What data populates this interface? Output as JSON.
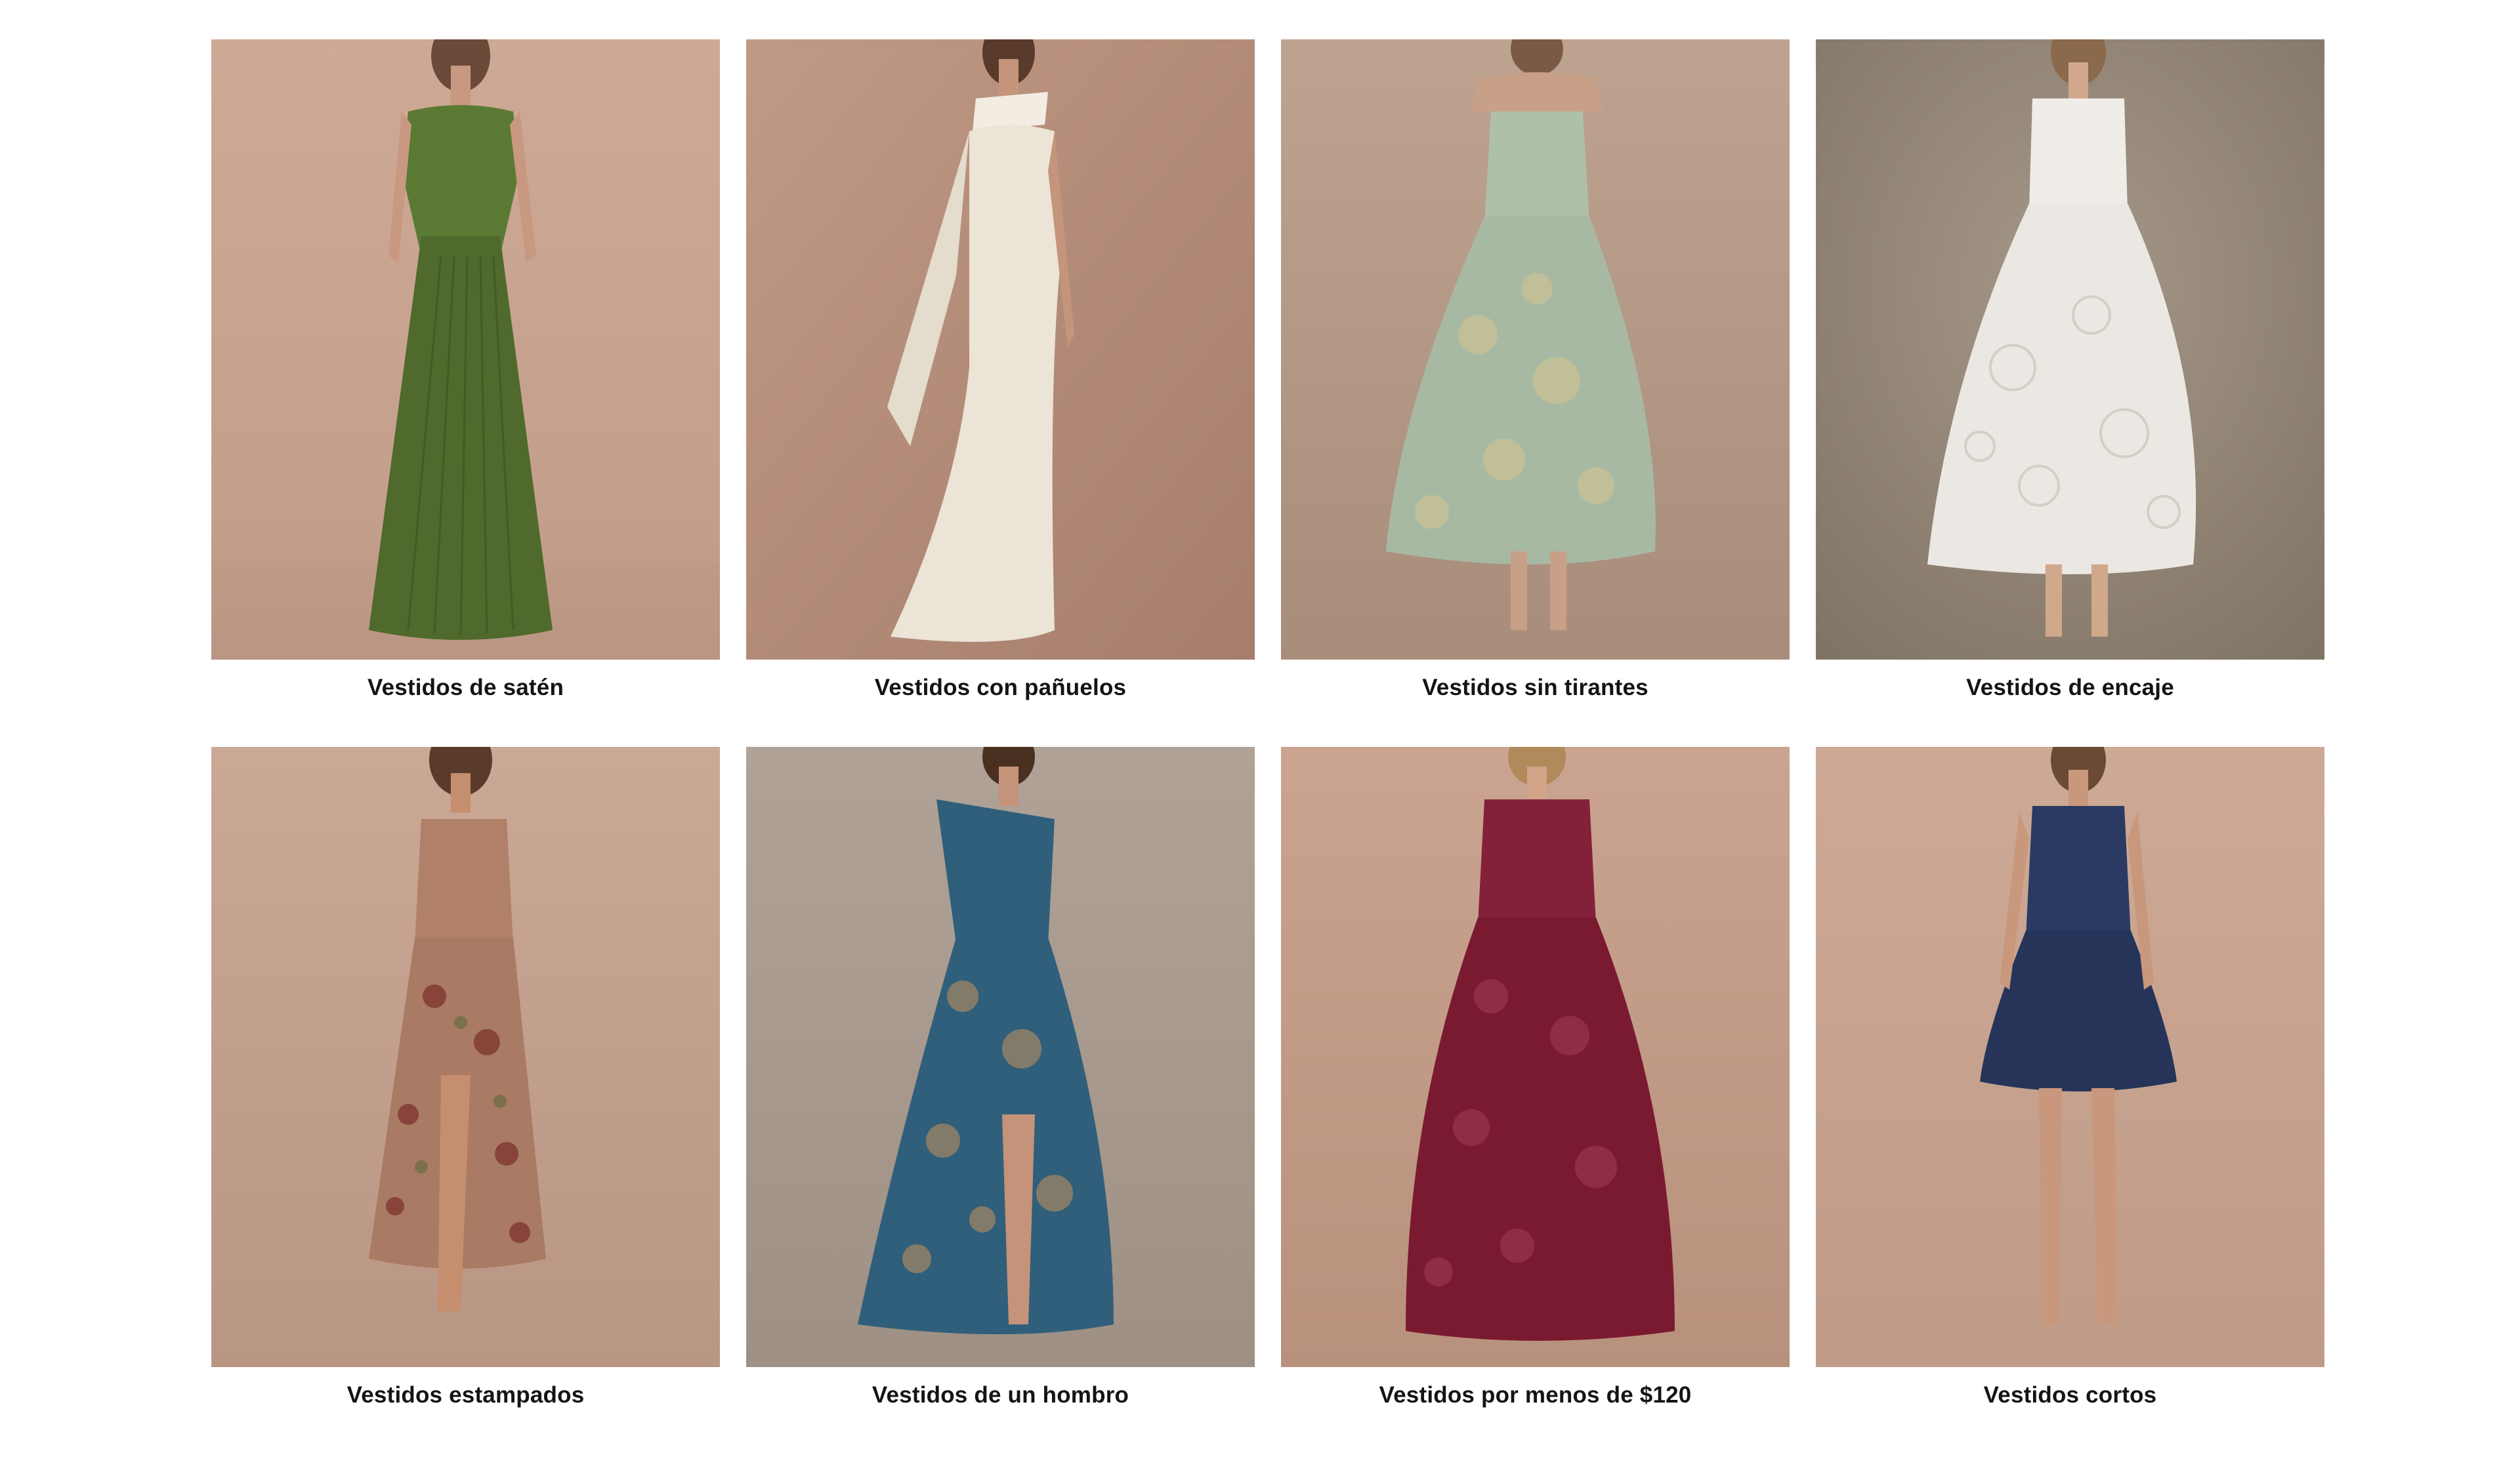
{
  "categories": [
    {
      "label": "Vestidos de satén",
      "image": "model-green-pleated-satin-gown",
      "dress_color": "#4f6a2c",
      "bg": "#c9a592"
    },
    {
      "label": "Vestidos con pañuelos",
      "image": "model-ivory-scarf-gown",
      "dress_color": "#ece4d6",
      "bg": "#b48a78"
    },
    {
      "label": "Vestidos sin tirantes",
      "image": "model-sage-jacquard-strapless-midi",
      "dress_color": "#a7b9a3",
      "bg": "#b59a88"
    },
    {
      "label": "Vestidos de encaje",
      "image": "model-white-lace-midi",
      "dress_color": "#ebe7e2",
      "bg": "#9c8e80"
    },
    {
      "label": "Vestidos estampados",
      "image": "model-floral-print-slit-dress",
      "dress_color": "#a97a64",
      "bg": "#c9a592"
    },
    {
      "label": "Vestidos de un hombro",
      "image": "model-blue-brocade-one-shoulder-gown",
      "dress_color": "#2f5f7a",
      "bg": "#a89a8e"
    },
    {
      "label": "Vestidos por menos de $120",
      "image": "model-burgundy-jacquard-gown",
      "dress_color": "#7a1a30",
      "bg": "#c29a86"
    },
    {
      "label": "Vestidos cortos",
      "image": "model-navy-short-dress",
      "dress_color": "#26345a",
      "bg": "#c9a592"
    }
  ]
}
